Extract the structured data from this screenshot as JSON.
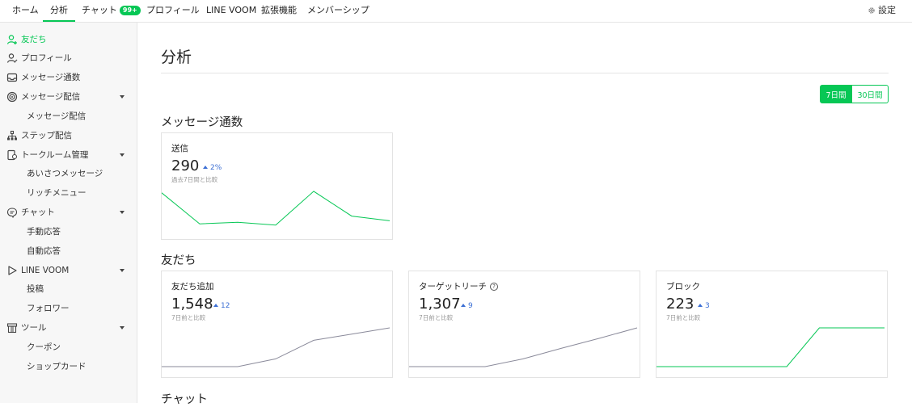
{
  "topnav": {
    "tabs": [
      {
        "label": "ホーム"
      },
      {
        "label": "分析"
      },
      {
        "label": "チャット",
        "badge": "99+"
      },
      {
        "label": "プロフィール"
      },
      {
        "label": "LINE VOOM"
      },
      {
        "label": "拡張機能"
      },
      {
        "label": "メンバーシップ"
      }
    ],
    "active_tab": "分析",
    "settings_label": "設定",
    "settings_icon": "gear-icon"
  },
  "sidebar": {
    "items": [
      {
        "label": "友だち",
        "icon": "add-friend-icon",
        "active": true
      },
      {
        "label": "プロフィール",
        "icon": "profile-icon"
      },
      {
        "label": "メッセージ通数",
        "icon": "inbox-icon"
      },
      {
        "label": "メッセージ配信",
        "icon": "broadcast-icon",
        "expandable": true
      },
      {
        "label": "メッセージ配信",
        "sub": true
      },
      {
        "label": "ステップ配信",
        "icon": "step-icon"
      },
      {
        "label": "トークルーム管理",
        "icon": "talkroom-icon",
        "expandable": true
      },
      {
        "label": "あいさつメッセージ",
        "sub": true
      },
      {
        "label": "リッチメニュー",
        "sub": true
      },
      {
        "label": "チャット",
        "icon": "chat-icon",
        "expandable": true
      },
      {
        "label": "手動応答",
        "sub": true
      },
      {
        "label": "自動応答",
        "sub": true
      },
      {
        "label": "LINE VOOM",
        "icon": "voom-icon",
        "expandable": true
      },
      {
        "label": "投稿",
        "sub": true
      },
      {
        "label": "フォロワー",
        "sub": true
      },
      {
        "label": "ツール",
        "icon": "tool-icon",
        "expandable": true
      },
      {
        "label": "クーポン",
        "sub": true
      },
      {
        "label": "ショップカード",
        "sub": true
      }
    ]
  },
  "main": {
    "title": "分析",
    "period": {
      "options": [
        "7日間",
        "30日間"
      ],
      "selected": "7日間"
    },
    "sections": {
      "messages": {
        "title": "メッセージ通数",
        "cards": [
          {
            "title": "送信",
            "value": "290",
            "delta": "2%",
            "compare": "過去7日間と比較"
          }
        ]
      },
      "friends": {
        "title": "友だち",
        "cards": [
          {
            "title": "友だち追加",
            "value": "1,548",
            "delta": "12",
            "compare": "7日前と比較"
          },
          {
            "title": "ターゲットリーチ",
            "value": "1,307",
            "delta": "9",
            "compare": "7日前と比較",
            "help_icon": "?"
          },
          {
            "title": "ブロック",
            "value": "223",
            "delta": "3",
            "compare": "7日前と比較"
          }
        ]
      },
      "chat": {
        "title": "チャット"
      }
    }
  },
  "colors": {
    "accent": "#06c755",
    "delta": "#3c6fd4",
    "sparkline_gray": "#8a8a9a"
  },
  "chart_data": [
    {
      "type": "line",
      "name": "送信",
      "values": [
        0.92,
        0.12,
        0.16,
        0.09,
        0.96,
        0.32,
        0.2
      ],
      "color": "#06c755"
    },
    {
      "type": "line",
      "name": "友だち追加",
      "values": [
        0.0,
        0.0,
        0.0,
        0.2,
        0.68,
        0.84,
        1.0
      ],
      "color": "#8a8a9a"
    },
    {
      "type": "line",
      "name": "ターゲットリーチ",
      "values": [
        0.0,
        0.0,
        0.0,
        0.2,
        0.47,
        0.73,
        1.0
      ],
      "color": "#8a8a9a"
    },
    {
      "type": "line",
      "name": "ブロック",
      "values": [
        0.0,
        0.0,
        0.0,
        0.0,
        0.0,
        1.0,
        1.0,
        1.0
      ],
      "color": "#06c755"
    }
  ]
}
